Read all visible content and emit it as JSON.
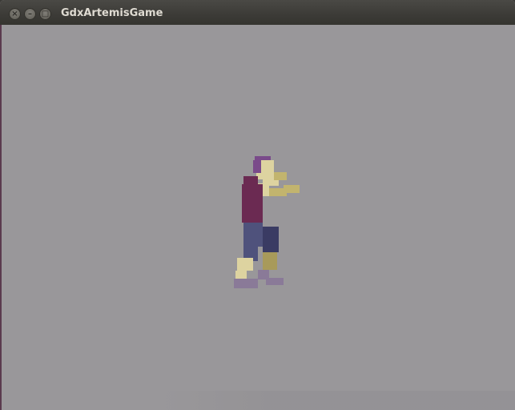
{
  "window": {
    "title": "GdxArtemisGame",
    "controls": {
      "close_icon": "close-icon",
      "minimize_icon": "minimize-icon",
      "maximize_icon": "maximize-icon"
    }
  },
  "game": {
    "background_color": "#99979a",
    "character": {
      "name": "fighter-sprite",
      "colors": {
        "hair": "#7a4a8a",
        "skin": "#ddd3a0",
        "shirt": "#6b2a52",
        "pants": "#4f527c",
        "pants_dark": "#3a3b63",
        "arm": "#c2b46e",
        "leg": "#a89a5a",
        "shoe": "#8a7a98"
      }
    }
  }
}
